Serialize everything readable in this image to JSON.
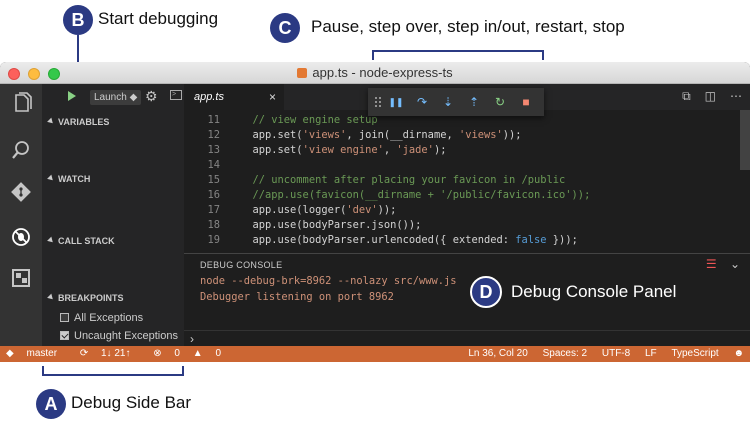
{
  "annotations": {
    "a": {
      "letter": "A",
      "text": "Debug Side Bar"
    },
    "b": {
      "letter": "B",
      "text": "Start debugging"
    },
    "c": {
      "letter": "C",
      "text": "Pause, step over, step in/out, restart, stop"
    },
    "d": {
      "letter": "D",
      "text": "Debug Console Panel"
    },
    "badge_color": "#2b3a83"
  },
  "window": {
    "title": "app.ts - node-express-ts"
  },
  "activity_bar": {
    "icons": [
      "files-icon",
      "search-icon",
      "git-icon",
      "debug-icon",
      "extensions-icon"
    ]
  },
  "sidebar": {
    "launch_config": "Launch",
    "sections": {
      "variables": "VARIABLES",
      "watch": "WATCH",
      "call_stack": "CALL STACK",
      "breakpoints": "BREAKPOINTS"
    },
    "breakpoints": [
      {
        "label": "All Exceptions",
        "checked": false
      },
      {
        "label": "Uncaught Exceptions",
        "checked": true
      }
    ]
  },
  "editor": {
    "tab_label": "app.ts",
    "tab_close": "×",
    "lines": [
      {
        "n": "11",
        "parts": [
          {
            "t": "  // view engine setup",
            "c": "c-com"
          }
        ]
      },
      {
        "n": "12",
        "parts": [
          {
            "t": "  app.set(",
            "c": "code-text"
          },
          {
            "t": "'views'",
            "c": "c-str"
          },
          {
            "t": ", join(__dirname, ",
            "c": "code-text"
          },
          {
            "t": "'views'",
            "c": "c-str"
          },
          {
            "t": "));",
            "c": "code-text"
          }
        ]
      },
      {
        "n": "13",
        "parts": [
          {
            "t": "  app.set(",
            "c": "code-text"
          },
          {
            "t": "'view engine'",
            "c": "c-str"
          },
          {
            "t": ", ",
            "c": "code-text"
          },
          {
            "t": "'jade'",
            "c": "c-str"
          },
          {
            "t": ");",
            "c": "code-text"
          }
        ]
      },
      {
        "n": "14",
        "parts": [
          {
            "t": "",
            "c": "code-text"
          }
        ]
      },
      {
        "n": "15",
        "parts": [
          {
            "t": "  // uncomment after placing your favicon in /public",
            "c": "c-com"
          }
        ]
      },
      {
        "n": "16",
        "parts": [
          {
            "t": "  //app.use(favicon(__dirname + '/public/favicon.ico'));",
            "c": "c-com"
          }
        ]
      },
      {
        "n": "17",
        "parts": [
          {
            "t": "  app.use(logger(",
            "c": "code-text"
          },
          {
            "t": "'dev'",
            "c": "c-str"
          },
          {
            "t": "));",
            "c": "code-text"
          }
        ]
      },
      {
        "n": "18",
        "parts": [
          {
            "t": "  app.use(bodyParser.json());",
            "c": "code-text"
          }
        ]
      },
      {
        "n": "19",
        "parts": [
          {
            "t": "  app.use(bodyParser.urlencoded({ extended: ",
            "c": "code-text"
          },
          {
            "t": "false",
            "c": "c-kw"
          },
          {
            "t": " }));",
            "c": "code-text"
          }
        ]
      }
    ]
  },
  "debug_toolbar": {
    "buttons": [
      {
        "name": "pause-button",
        "glyph": "❚❚",
        "color": "#75beff"
      },
      {
        "name": "step-over-button",
        "glyph": "↷",
        "color": "#75beff"
      },
      {
        "name": "step-into-button",
        "glyph": "⇣",
        "color": "#75beff"
      },
      {
        "name": "step-out-button",
        "glyph": "⇡",
        "color": "#75beff"
      },
      {
        "name": "restart-button",
        "glyph": "↻",
        "color": "#89d185"
      },
      {
        "name": "stop-button",
        "glyph": "■",
        "color": "#f48771"
      }
    ]
  },
  "panel": {
    "title": "DEBUG CONSOLE",
    "lines": [
      "node --debug-brk=8962 --nolazy src/www.js",
      "Debugger listening on port 8962"
    ],
    "prompt": "›"
  },
  "status_bar": {
    "branch": "master",
    "sync": "1↓ 21↑",
    "errors": "0",
    "warnings": "0",
    "position": "Ln 36, Col 20",
    "spaces": "Spaces: 2",
    "encoding": "UTF-8",
    "eol": "LF",
    "language": "TypeScript",
    "color": "#cc6633"
  }
}
